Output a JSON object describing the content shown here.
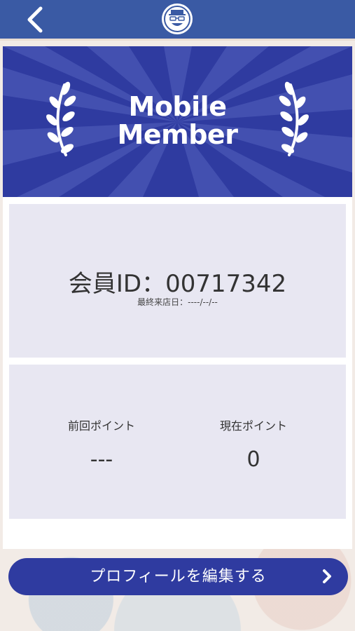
{
  "header": {
    "back_icon": "chevron-left-icon",
    "logo_icon": "avatar-glasses-logo-icon",
    "bar_color": "#3a5aa4"
  },
  "banner": {
    "title_line1": "Mobile",
    "title_line2": "Member",
    "color": "#2f3ba0"
  },
  "member": {
    "id_text": "会員ID：00717342",
    "last_visit_text": "最終来店日：----/--/--"
  },
  "points": {
    "previous_label": "前回ポイント",
    "previous_value": "---",
    "current_label": "現在ポイント",
    "current_value": "0"
  },
  "actions": {
    "edit_profile_label": "プロフィールを編集する",
    "edit_icon": "chevron-right-icon"
  }
}
